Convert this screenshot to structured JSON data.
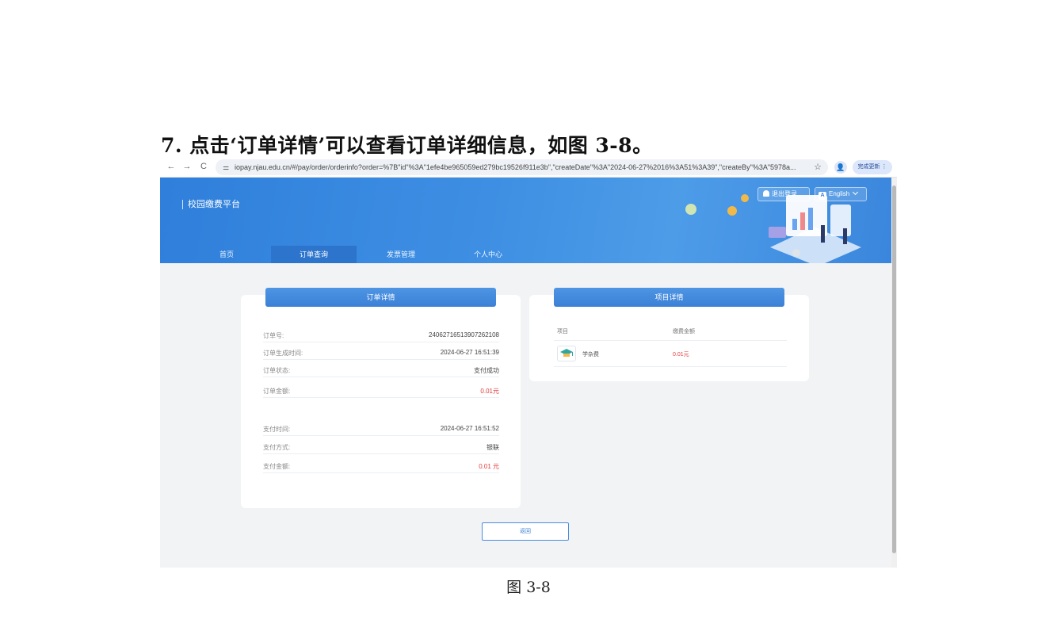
{
  "document": {
    "heading": "7. 点击‘订单详情’可以查看订单详细信息，如图 3-8。",
    "caption": "图 3-8"
  },
  "browser": {
    "url": "iopay.njau.edu.cn/#/pay/order/orderinfo?order=%7B\"id\"%3A\"1efe4be965059ed279bc19526f911e3b\",\"createDate\"%3A\"2024-06-27%2016%3A51%3A39\",\"createBy\"%3A\"5978a...",
    "update_label": "完成更新",
    "back_glyph": "←",
    "forward_glyph": "→",
    "reload_glyph": "C",
    "tune_glyph": "⚌",
    "star_glyph": "☆",
    "profile_glyph": "👤",
    "menu_glyph": "⋮"
  },
  "header": {
    "brand": "校园缴费平台",
    "logout_label": "退出登录",
    "lang_badge": "A",
    "lang_label": "English",
    "tabs": [
      {
        "label": "首页"
      },
      {
        "label": "订单查询"
      },
      {
        "label": "发票管理"
      },
      {
        "label": "个人中心"
      }
    ],
    "active_tab_color": "#2c74cc",
    "primary_color": "#3a86dd"
  },
  "order_card": {
    "title": "订单详情",
    "rows": [
      {
        "label": "订单号:",
        "value": "24062716513907262108"
      },
      {
        "label": "订单生成时间:",
        "value": "2024-06-27 16:51:39"
      },
      {
        "label": "订单状态:",
        "value": "支付成功"
      },
      {
        "label": "订单金额:",
        "value": "0.01元"
      },
      {
        "label": "支付时间:",
        "value": "2024-06-27 16:51:52"
      },
      {
        "label": "支付方式:",
        "value": "银联"
      },
      {
        "label": "支付金额:",
        "value": "0.01 元"
      }
    ],
    "amount_color": "#e23b3b"
  },
  "project_card": {
    "title": "项目详情",
    "col_item": "项目",
    "col_amount": "缴费金额",
    "item_name": "学杂费",
    "item_amount": "0.01元",
    "item_icon": "graduation-cap-icon"
  },
  "back_button": "返回"
}
